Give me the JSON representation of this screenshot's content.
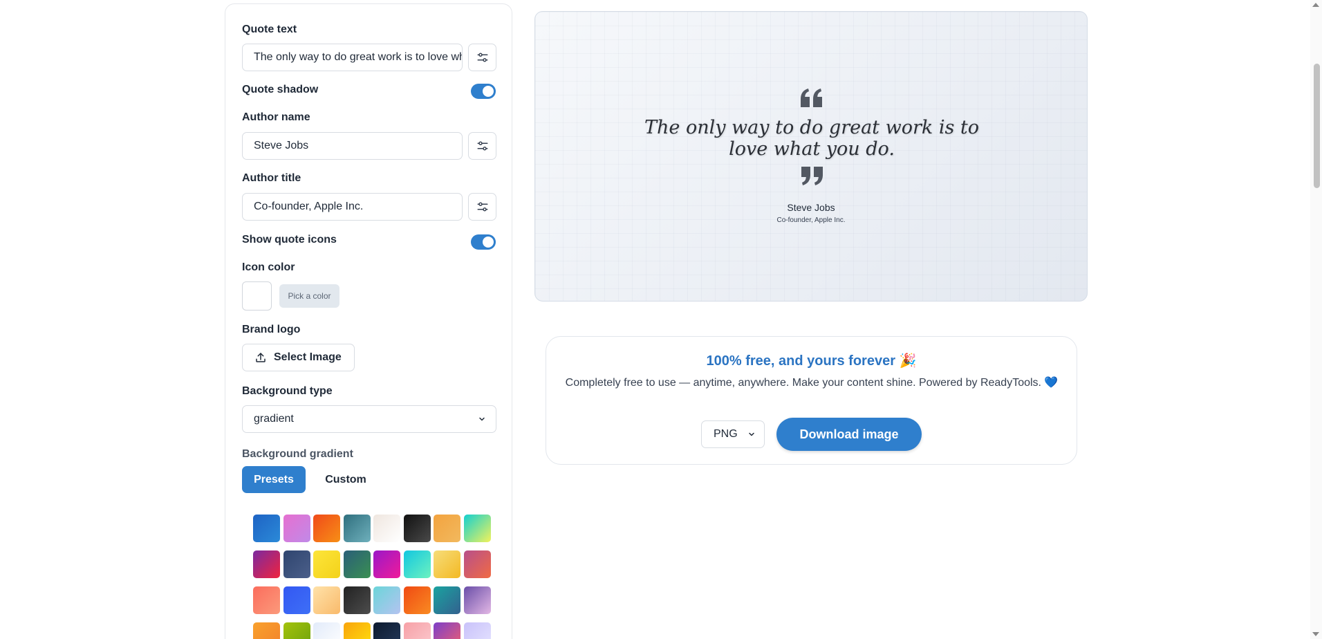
{
  "editor": {
    "quote_text_label": "Quote text",
    "quote_text_value": "The only way to do great work is to love what you do.",
    "quote_shadow_label": "Quote shadow",
    "quote_shadow_on": true,
    "author_name_label": "Author name",
    "author_name_value": "Steve Jobs",
    "author_title_label": "Author title",
    "author_title_value": "Co-founder, Apple Inc.",
    "show_icons_label": "Show quote icons",
    "show_icons_on": true,
    "icon_color_label": "Icon color",
    "pick_color_label": "Pick a color",
    "brand_logo_label": "Brand logo",
    "select_image_label": "Select Image",
    "bg_type_label": "Background type",
    "bg_type_value": "gradient",
    "bg_gradient_label": "Background gradient",
    "tabs": [
      {
        "label": "Presets",
        "active": true
      },
      {
        "label": "Custom",
        "active": false
      }
    ],
    "presets": [
      [
        "#1e63c4",
        "#2b8ad8"
      ],
      [
        "#e66fd0",
        "#c08ae8"
      ],
      [
        "#f04a1a",
        "#f78f16"
      ],
      [
        "#2f6f7e",
        "#6fb0bc"
      ],
      [
        "#efe6df",
        "#ffffff"
      ],
      [
        "#111111",
        "#4a4a4a"
      ],
      [
        "#f3a33f",
        "#f2b95e"
      ],
      [
        "#13d0d0",
        "#f2f25a"
      ],
      [
        "#7b2aa0",
        "#f0233e"
      ],
      [
        "#2f456f",
        "#4b5f8a"
      ],
      [
        "#fde53a",
        "#f3d21a"
      ],
      [
        "#2a5f78",
        "#3a8f52"
      ],
      [
        "#9a19c8",
        "#f01a9a"
      ],
      [
        "#12c7e0",
        "#6df2c0"
      ],
      [
        "#f6dd7a",
        "#f4b924"
      ],
      [
        "#b8508a",
        "#f06a44"
      ],
      [
        "#fb6d5d",
        "#fb9a7b"
      ],
      [
        "#3358f2",
        "#3e6ff7"
      ],
      [
        "#ffe2a9",
        "#f9ba6b"
      ],
      [
        "#222222",
        "#4d4d4d"
      ],
      [
        "#6bd5d9",
        "#b4c3f0"
      ],
      [
        "#f04a13",
        "#f98b22"
      ],
      [
        "#1aa3a0",
        "#33618f"
      ],
      [
        "#6a4ea8",
        "#e3b8e5"
      ],
      [
        "#f9a12d",
        "#f2822c"
      ],
      [
        "#a4c20c",
        "#6ca20d"
      ],
      [
        "#e2ebfa",
        "#ffffff"
      ],
      [
        "#f9a40c",
        "#ffe10e"
      ],
      [
        "#0d1a2e",
        "#243a5c"
      ],
      [
        "#f7a0a6",
        "#fbcbd0"
      ],
      [
        "#7c3fc9",
        "#f2606e"
      ],
      [
        "#c9c2fa",
        "#e6e4ff"
      ]
    ]
  },
  "preview": {
    "quote": "The only way to do great work is to love what you do.",
    "author": "Steve Jobs",
    "title": "Co-founder, Apple Inc.",
    "icon_color": "#525862"
  },
  "card": {
    "heading": "100% free, and yours forever 🎉",
    "text": "Completely free to use — anytime, anywhere. Make your content shine. Powered by ReadyTools. 💙",
    "format_value": "PNG",
    "download_label": "Download image"
  }
}
